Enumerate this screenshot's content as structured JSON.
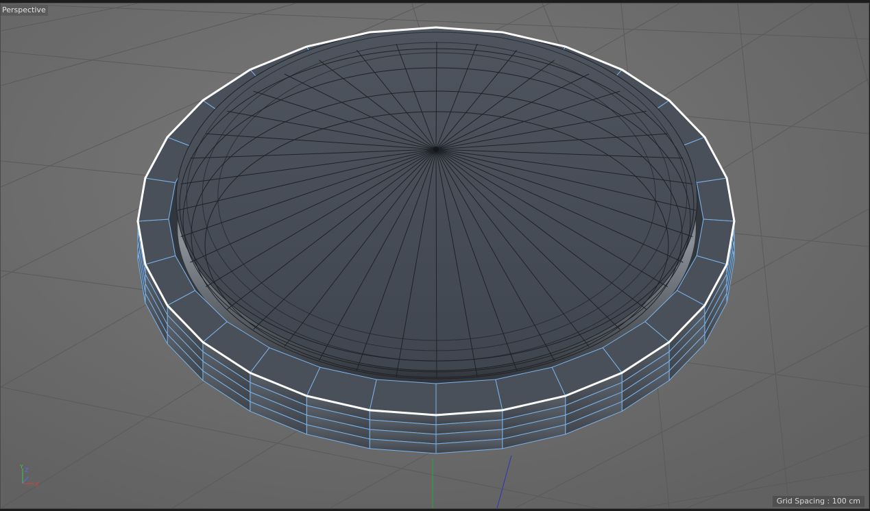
{
  "viewport": {
    "camera_label": "Perspective",
    "grid_spacing_text": "Grid Spacing : 100 cm"
  },
  "axis_gizmo": {
    "y_label": "Y",
    "z_label": "Z",
    "x_label": "X",
    "colors": {
      "y": "#3ec83e",
      "z": "#4f6fff",
      "x": "#e03a3a"
    }
  },
  "scene_colors": {
    "background": "#6d6d6d",
    "grid_line": "#5a5a5a",
    "mesh_face": "#464c55",
    "mesh_wire": "#1e2126",
    "selected_wire": "#7ab4ec",
    "selection_outline": "#ffffff"
  }
}
